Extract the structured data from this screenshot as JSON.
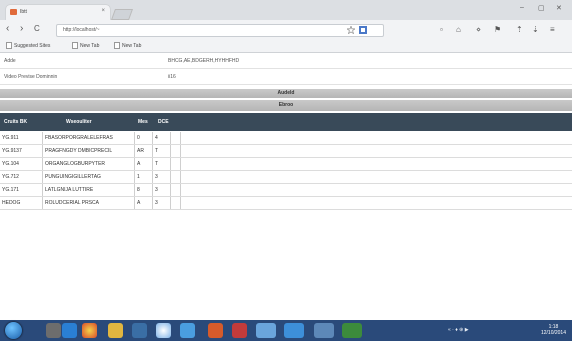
{
  "browser": {
    "tab_title": "Ibtt",
    "tab_close": "×",
    "window_controls": [
      "–",
      "▢",
      "✕"
    ],
    "nav": {
      "back": "‹",
      "forward": "›",
      "reload": "C"
    },
    "url": "http://localhost/~",
    "bookmarks": [
      "Suggested Sites",
      "New Tab",
      "New Tab"
    ],
    "icons": [
      "star-icon",
      "menu-icon"
    ]
  },
  "info": [
    {
      "label": "Adde",
      "value": "BHCG,AE,BDGERH,HYHHFHD"
    },
    {
      "label": "Video Previse Dominnin",
      "value": "ii16"
    }
  ],
  "bands": [
    "Audeld",
    "Ebroo"
  ],
  "table": {
    "headers": [
      "Cruits BK",
      "Wseouliter",
      "Mes",
      "DCE"
    ],
    "rows": [
      [
        "YG.911",
        "FBASORPORGRALELEFRAS",
        "0",
        "4"
      ],
      [
        "YG.9137",
        "PRAGFNGDY DMBICPRECIL",
        "AR",
        "T"
      ],
      [
        "YG.104",
        "ORGANGLOGBURPYTER",
        "A",
        "T"
      ],
      [
        "YG.712",
        "PUNGUINGIGILLERTAG",
        "1",
        "3"
      ],
      [
        "YG.171",
        "LATLGNIJA LUTTIRE",
        "8",
        "3"
      ],
      [
        "HEDOG",
        "ROLUDCERIAL PRSCA",
        "A",
        "3"
      ]
    ]
  },
  "taskbar": {
    "tray_text": "« · ♦ ⊕ ▶",
    "clock_time": "1:18",
    "clock_date": "12/10/2014"
  }
}
